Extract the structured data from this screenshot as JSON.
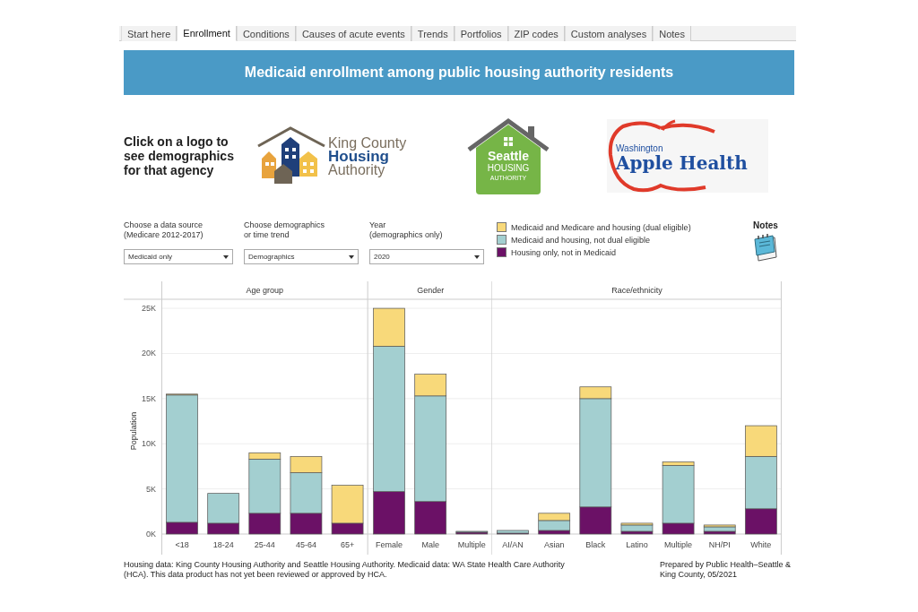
{
  "tabs": [
    {
      "label": "Start here",
      "selected": false
    },
    {
      "label": "Enrollment",
      "selected": true
    },
    {
      "label": "Conditions",
      "selected": false
    },
    {
      "label": "Causes of acute events",
      "selected": false
    },
    {
      "label": "Trends",
      "selected": false
    },
    {
      "label": "Portfolios",
      "selected": false
    },
    {
      "label": "ZIP codes",
      "selected": false
    },
    {
      "label": "Custom analyses",
      "selected": false
    },
    {
      "label": "Notes",
      "selected": false
    }
  ],
  "banner": {
    "title": "Medicaid enrollment among public housing authority residents"
  },
  "agency_picker": {
    "prompt": "Click on a logo to see demographics for that agency",
    "logos": [
      {
        "kind": "kcha",
        "lines": [
          "King County",
          "Housing",
          "Authority"
        ]
      },
      {
        "kind": "sha",
        "lines": [
          "Seattle",
          "HOUSING",
          "AUTHORITY"
        ]
      },
      {
        "kind": "apple",
        "lines": [
          "Washington",
          "Apple Health"
        ]
      }
    ]
  },
  "filters": [
    {
      "label_lines": [
        "Choose a data source",
        "(Medicare 2012-2017)"
      ],
      "value": "Medicaid only"
    },
    {
      "label_lines": [
        "Choose demographics",
        "or time trend"
      ],
      "value": "Demographics"
    },
    {
      "label_lines": [
        "Year",
        "(demographics only)"
      ],
      "value": "2020"
    }
  ],
  "notes": {
    "label": "Notes"
  },
  "chart": {
    "panels": [
      {
        "chart_data": {
          "type": "bar",
          "stacked": true,
          "orientation": "vertical",
          "grid": true,
          "title": "Age group",
          "ylabel": "Population",
          "categories": [
            "<18",
            "18-24",
            "25-44",
            "45-64",
            "65+"
          ],
          "ylim": [
            0,
            26000
          ],
          "yticks": [
            {
              "value": 0,
              "label": "0K"
            },
            {
              "value": 5000,
              "label": "5K"
            },
            {
              "value": 10000,
              "label": "10K"
            },
            {
              "value": 15000,
              "label": "15K"
            },
            {
              "value": 20000,
              "label": "20K"
            },
            {
              "value": 25000,
              "label": "25K"
            }
          ],
          "series": [
            {
              "name": "Housing only, not in Medicaid",
              "color": "#6b1166",
              "values": [
                1300,
                1200,
                2300,
                2300,
                1200
              ]
            },
            {
              "name": "Medicaid and housing, not dual eligible",
              "color": "#a3cfd0",
              "values": [
                14100,
                3300,
                6000,
                4500,
                null
              ]
            },
            {
              "name": "Medicaid and Medicare and housing (dual eligible)",
              "color": "#f8d97a",
              "values": [
                100,
                null,
                700,
                1800,
                4200
              ]
            }
          ]
        }
      },
      {
        "chart_data": {
          "type": "bar",
          "stacked": true,
          "orientation": "vertical",
          "grid": true,
          "title": "Gender",
          "categories": [
            "Female",
            "Male",
            "Multiple"
          ],
          "ylim": [
            0,
            26000
          ],
          "series": [
            {
              "color": "#6b1166",
              "values": [
                4700,
                3600,
                200
              ]
            },
            {
              "color": "#a3cfd0",
              "values": [
                16100,
                11700,
                100
              ]
            },
            {
              "color": "#f8d97a",
              "values": [
                4200,
                2400,
                0
              ]
            }
          ]
        }
      },
      {
        "chart_data": {
          "type": "bar",
          "stacked": true,
          "orientation": "vertical",
          "grid": true,
          "title": "Race/ethnicity",
          "categories": [
            "AI/AN",
            "Asian",
            "Black",
            "Latino",
            "Multiple",
            "NH/PI",
            "White"
          ],
          "ylim": [
            0,
            26000
          ],
          "series": [
            {
              "color": "#6b1166",
              "values": [
                100,
                400,
                3000,
                300,
                1200,
                300,
                2800
              ]
            },
            {
              "color": "#a3cfd0",
              "values": [
                300,
                1100,
                12000,
                700,
                6400,
                500,
                5800
              ]
            },
            {
              "color": "#f8d97a",
              "values": [
                0,
                800,
                1300,
                200,
                400,
                200,
                3400
              ]
            }
          ]
        }
      }
    ]
  },
  "footer": {
    "source": "Housing data: King County Housing Authority and Seattle Housing Authority. Medicaid data: WA State Health Care Authority (HCA). This data product has not yet been reviewed or approved by HCA.",
    "credit": "Prepared by Public Health–Seattle & King County, 05/2021"
  }
}
